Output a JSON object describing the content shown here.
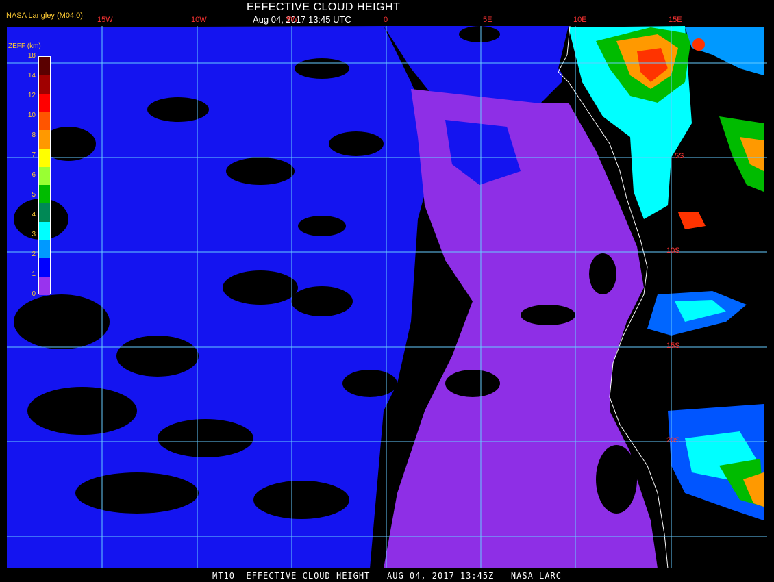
{
  "header": {
    "agency": "NASA Langley (M04.0)",
    "title": "EFFECTIVE CLOUD HEIGHT",
    "subtitle": "Aug 04, 2017 13:45 UTC"
  },
  "footer": {
    "text": "MT10  EFFECTIVE CLOUD HEIGHT   AUG 04, 2017 13:45Z   NASA LARC"
  },
  "longitude_labels": [
    "15W",
    "10W",
    "5W",
    "0",
    "5E",
    "10E",
    "15E"
  ],
  "latitude_labels": [
    "5S",
    "10S",
    "15S",
    "20S"
  ],
  "legend": {
    "title": "ZEFF (km)",
    "ticks": [
      "18",
      "14",
      "12",
      "10",
      "8",
      "7",
      "6",
      "5",
      "4",
      "3",
      "2",
      "1",
      "0"
    ],
    "colors": [
      "#5a0000",
      "#a00000",
      "#ff0000",
      "#ff5500",
      "#ff9900",
      "#ffff00",
      "#99ff33",
      "#00bb00",
      "#008855",
      "#00ffff",
      "#0099ff",
      "#0000ff",
      "#9933ee"
    ]
  },
  "map_colors": {
    "background": "#000000",
    "grid": "#66ccff",
    "coast": "#ffffff",
    "low": "#9933ee",
    "mid": "#0000ff",
    "high": "#00ffff"
  }
}
